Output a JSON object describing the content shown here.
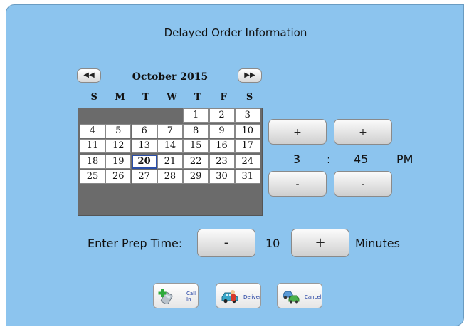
{
  "dialog": {
    "title": "Delayed Order Information"
  },
  "calendar": {
    "prev_icon": "rewind-icon",
    "next_icon": "fast-forward-icon",
    "prev_glyph": "◀◀",
    "next_glyph": "▶▶",
    "month_label": "October 2015",
    "weekdays": [
      "S",
      "M",
      "T",
      "W",
      "T",
      "F",
      "S"
    ],
    "days": [
      "1",
      "2",
      "3",
      "4",
      "5",
      "6",
      "7",
      "8",
      "9",
      "10",
      "11",
      "12",
      "13",
      "14",
      "15",
      "16",
      "17",
      "18",
      "19",
      "20",
      "21",
      "22",
      "23",
      "24",
      "25",
      "26",
      "27",
      "28",
      "29",
      "30",
      "31"
    ],
    "selected_day": "20"
  },
  "time": {
    "hour_up_label": "+",
    "minute_up_label": "+",
    "hour_down_label": "-",
    "minute_down_label": "-",
    "hour": "3",
    "separator": ":",
    "minute": "45",
    "ampm": "PM"
  },
  "prep": {
    "label": "Enter Prep Time:",
    "minus_label": "-",
    "value": "10",
    "plus_label": "+",
    "unit": "Minutes"
  },
  "actions": {
    "call_in": {
      "label_line1": "Call",
      "label_line2": "In",
      "icon": "phone-icon"
    },
    "deliver": {
      "label": "Deliver",
      "icon": "delivery-car-icon"
    },
    "cancel": {
      "label": "Cancel",
      "icon": "cancel-car-icon"
    }
  },
  "colors": {
    "background": "#8cc4ee",
    "selected_border": "#2b4fa8",
    "calendar_filler": "#6b6b6b"
  }
}
